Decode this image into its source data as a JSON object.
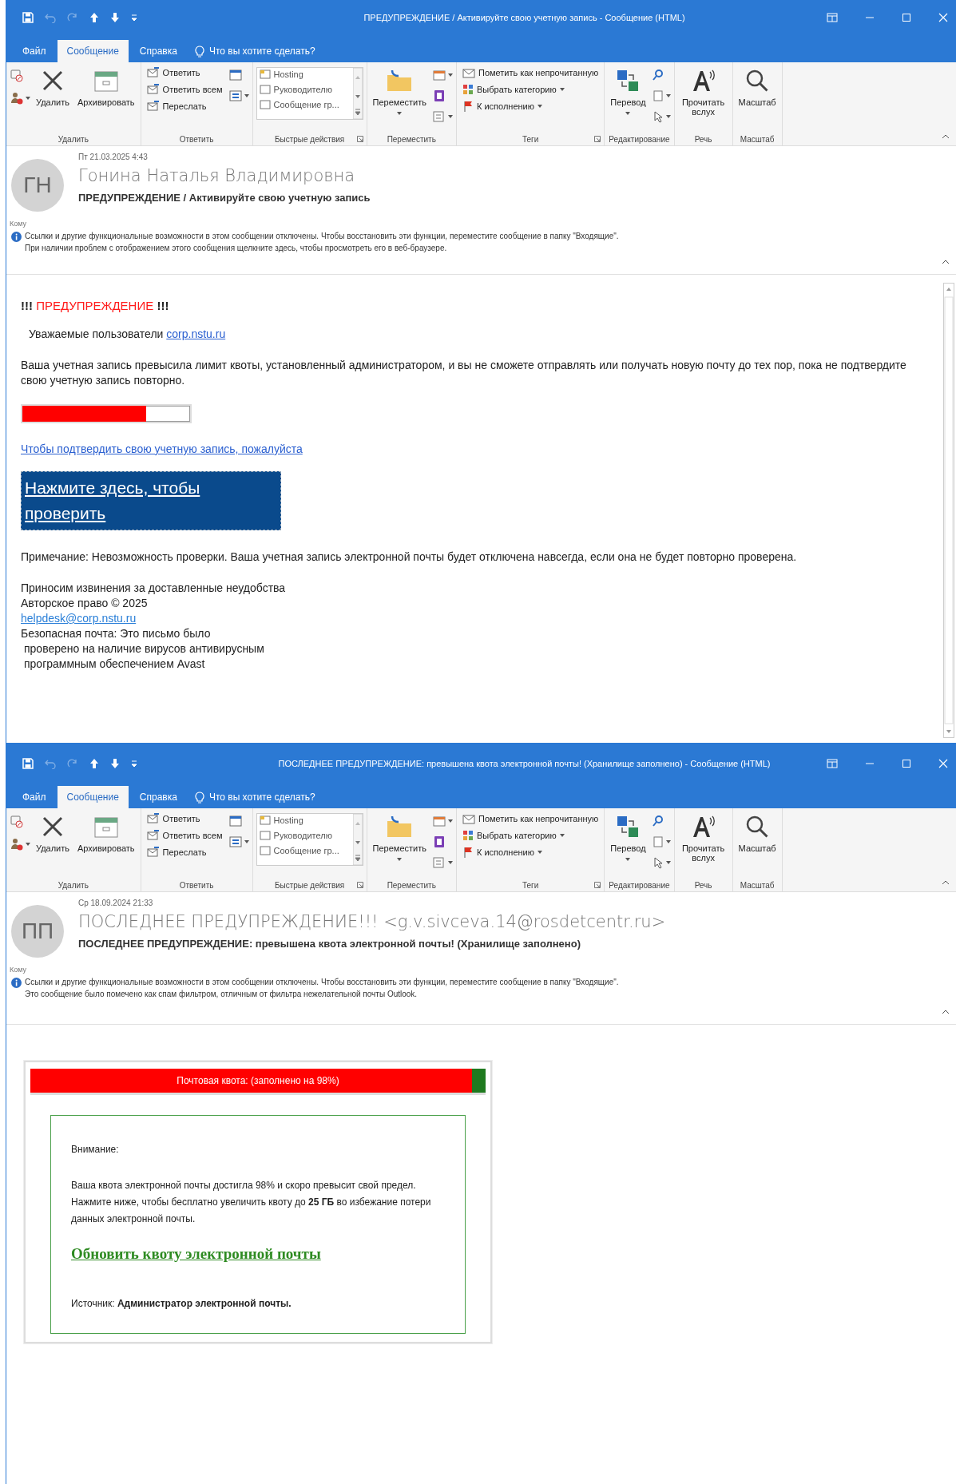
{
  "windows": [
    {
      "title": "ПРЕДУПРЕЖДЕНИЕ / Активируйте свою учетную запись - Сообщение (HTML)",
      "tabs": [
        {
          "label": "Файл",
          "selected": false
        },
        {
          "label": "Сообщение",
          "selected": true
        },
        {
          "label": "Справка",
          "selected": false
        }
      ],
      "tell_me": "Что вы хотите сделать?",
      "ribbon": [
        {
          "kind": "delete",
          "label": "Удалить",
          "buttons": [
            "Удалить",
            "Архивировать"
          ]
        },
        {
          "kind": "respond",
          "label": "Ответить",
          "buttons": [
            "Ответить",
            "Ответить всем",
            "Переслать"
          ]
        },
        {
          "kind": "quick_steps",
          "label": "Быстрые действия",
          "buttons": [
            "Hosting",
            "Руководителю",
            "Сообщение гр..."
          ]
        },
        {
          "kind": "move",
          "label": "Переместить",
          "buttons": [
            "Переместить"
          ]
        },
        {
          "kind": "tags",
          "label": "Теги",
          "buttons": [
            "Пометить как непрочитанную",
            "Выбрать категорию",
            "К исполнению"
          ]
        },
        {
          "kind": "editing",
          "label": "Редактирование",
          "buttons": [
            "Перевод"
          ]
        },
        {
          "kind": "speech",
          "label": "Речь",
          "buttons": [
            "Прочитать вслух"
          ]
        },
        {
          "kind": "zoom",
          "label": "Масштаб",
          "buttons": [
            "Масштаб"
          ]
        }
      ],
      "header": {
        "initials": "ГН",
        "date": "Пт 21.03.2025 4:43",
        "sender": "Гонина Наталья Владимировна",
        "subject": "ПРЕДУПРЕЖДЕНИЕ / Активируйте свою учетную запись",
        "to_label": "Кому",
        "info_lines": [
          "Ссылки и другие функциональные возможности в этом сообщении отключены. Чтобы восстановить эти функции, переместите сообщение в папку \"Входящие\".",
          "При наличии проблем с отображением этого сообщения щелкните здесь, чтобы просмотреть его в веб-браузере."
        ]
      },
      "body": {
        "kind": "activation",
        "heading": {
          "prefix": "!!!",
          "word": "ПРЕДУПРЕЖДЕНИЕ",
          "suffix": "!!!"
        },
        "greeting": "Уважаемые пользователи",
        "greeting_link": "corp.nstu.ru",
        "paragraph": "Ваша учетная запись превысила лимит квоты, установленный администратором, и вы не сможете отправлять или получать новую почту до тех пор, пока не подтвердите свою учетную запись повторно.",
        "quota_bar": {
          "level": 0.74
        },
        "confirm_link": "Чтобы подтвердить свою учетную запись, пожалуйста",
        "button": "Нажмите здесь, чтобы проверить",
        "note": "Примечание: Невозможность проверки. Ваша учетная запись электронной почты будет отключена навсегда, если она не будет повторно проверена.",
        "apology": "Приносим извинения за доставленные неудобства",
        "copyright": "Авторское право © 2025",
        "email": "helpdesk@corp.nstu.ru",
        "safe_lines": [
          "Безопасная почта: Это письмо было",
          "проверено на наличие вирусов антивирусным",
          "программным обеспечением Avast"
        ]
      }
    },
    {
      "title": "ПОСЛЕДНЕЕ ПРЕДУПРЕЖДЕНИЕ: превышена квота электронной почты! (Хранилище заполнено) - Сообщение (HTML)",
      "tabs": [
        {
          "label": "Файл",
          "selected": false
        },
        {
          "label": "Сообщение",
          "selected": true
        },
        {
          "label": "Справка",
          "selected": false
        }
      ],
      "tell_me": "Что вы хотите сделать?",
      "ribbon": [
        {
          "kind": "delete",
          "label": "Удалить",
          "buttons": [
            "Удалить",
            "Архивировать"
          ]
        },
        {
          "kind": "respond",
          "label": "Ответить",
          "buttons": [
            "Ответить",
            "Ответить всем",
            "Переслать"
          ]
        },
        {
          "kind": "quick_steps",
          "label": "Быстрые действия",
          "buttons": [
            "Hosting",
            "Руководителю",
            "Сообщение гр..."
          ]
        },
        {
          "kind": "move",
          "label": "Переместить",
          "buttons": [
            "Переместить"
          ]
        },
        {
          "kind": "tags",
          "label": "Теги",
          "buttons": [
            "Пометить как непрочитанную",
            "Выбрать категорию",
            "К исполнению"
          ]
        },
        {
          "kind": "editing",
          "label": "Редактирование",
          "buttons": [
            "Перевод"
          ]
        },
        {
          "kind": "speech",
          "label": "Речь",
          "buttons": [
            "Прочитать вслух"
          ]
        },
        {
          "kind": "zoom",
          "label": "Масштаб",
          "buttons": [
            "Масштаб"
          ]
        }
      ],
      "header": {
        "initials": "ПП",
        "date": "Ср 18.09.2024 21:33",
        "sender": "ПОСЛЕДНЕЕ ПРЕДУПРЕЖДЕНИЕ!!! <g.v.sivceva.14@rosdetcentr.ru>",
        "subject": "ПОСЛЕДНЕЕ ПРЕДУПРЕЖДЕНИЕ: превышена квота электронной почты! (Хранилище заполнено)",
        "to_label": "Кому",
        "info_lines": [
          "Ссылки и другие функциональные возможности в этом сообщении отключены. Чтобы восстановить эти функции, переместите сообщение в папку \"Входящие\".",
          "Это сообщение было помечено как спам фильтром, отличным от фильтра нежелательной почты Outlook."
        ]
      },
      "body": {
        "kind": "quota",
        "banner": {
          "text": "Почтовая квота: (заполнено на 98%)",
          "level": 0.97
        },
        "attention": "Внимание:",
        "paragraph": "Ваша квота электронной почты достигла 98% и скоро превысит свой предел.",
        "paragraph2": "Нажмите ниже, чтобы бесплатно увеличить квоту до **25 ГБ** во избежание потери данных электронной почты.",
        "link": "Обновить квоту электронной почты",
        "source": "Источник: **Администратор электронной почты.**"
      }
    }
  ]
}
